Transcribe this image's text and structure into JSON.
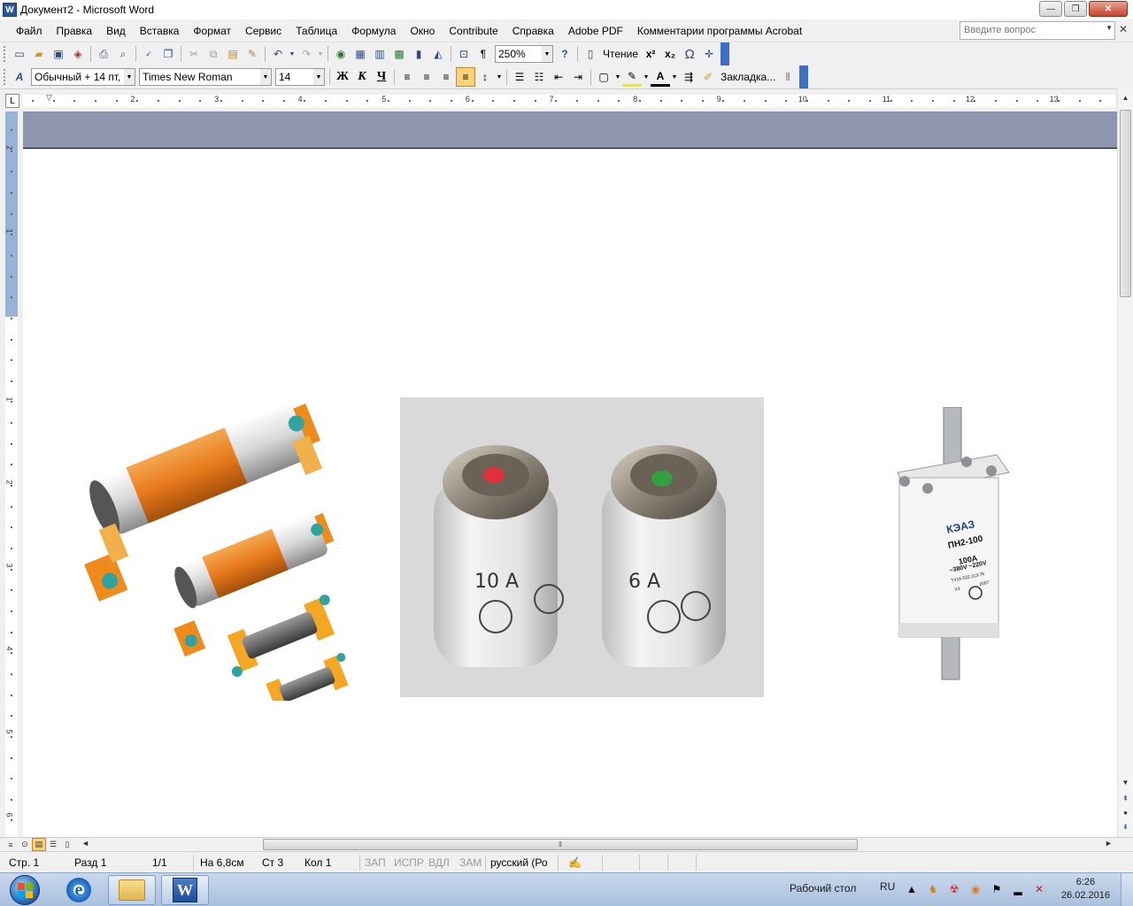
{
  "window": {
    "title": "Документ2 - Microsoft Word",
    "app_icon_letter": "W",
    "minimize_glyph": "—",
    "restore_glyph": "❐",
    "close_glyph": "✕"
  },
  "menu": {
    "items": [
      "Файл",
      "Правка",
      "Вид",
      "Вставка",
      "Формат",
      "Сервис",
      "Таблица",
      "Формула",
      "Окно",
      "Contribute",
      "Справка",
      "Adobe PDF",
      "Комментарии программы Acrobat"
    ],
    "ask_placeholder": "Введите вопрос",
    "close_doc_glyph": "✕"
  },
  "toolbar_standard": {
    "zoom": "250%",
    "reading_label": "Чтение",
    "superscript": "x²",
    "subscript": "x₂",
    "omega": "Ω"
  },
  "toolbar_format": {
    "style": "Обычный + 14 пт,",
    "font": "Times New Roman",
    "size": "14",
    "bold": "Ж",
    "italic": "К",
    "underline": "Ч",
    "bookmark_label": "Закладка..."
  },
  "ruler": {
    "numbers": [
      "2",
      "3",
      "4",
      "5",
      "6",
      "7",
      "8",
      "9",
      "10",
      "11",
      "12",
      "13"
    ],
    "vnumbers": [
      "2",
      "1",
      "1",
      "2",
      "3",
      "4",
      "5",
      "6"
    ]
  },
  "status": {
    "page": "Стр. 1",
    "section": "Разд 1",
    "pages": "1/1",
    "at": "На 6,8см",
    "line": "Ст 3",
    "col": "Кол 1",
    "rec": "ЗАП",
    "trk": "ИСПР",
    "ext": "ВДЛ",
    "ovr": "ЗАМ",
    "lang": "русский (Ро"
  },
  "figures": {
    "fuse2_left_label": "10 А",
    "fuse2_right_label": "6 А",
    "fuse3_brand": "КЭАЗ",
    "fuse3_model": "ПН2-100",
    "fuse3_current": "100A",
    "fuse3_voltage": "~380V ~220V",
    "fuse3_spec": "ТУ16-522.113-75",
    "fuse3_code": "У3",
    "fuse3_year": "2007",
    "colors": {
      "orange": "#e8791c",
      "fuse_red_dot": "#e0303a",
      "fuse_green_dot": "#30a040",
      "photo_bg": "#d9d9d9"
    }
  },
  "taskbar": {
    "desktop_label": "Рабочий стол",
    "lang": "RU",
    "time": "6:26",
    "date": "26.02.2016"
  }
}
